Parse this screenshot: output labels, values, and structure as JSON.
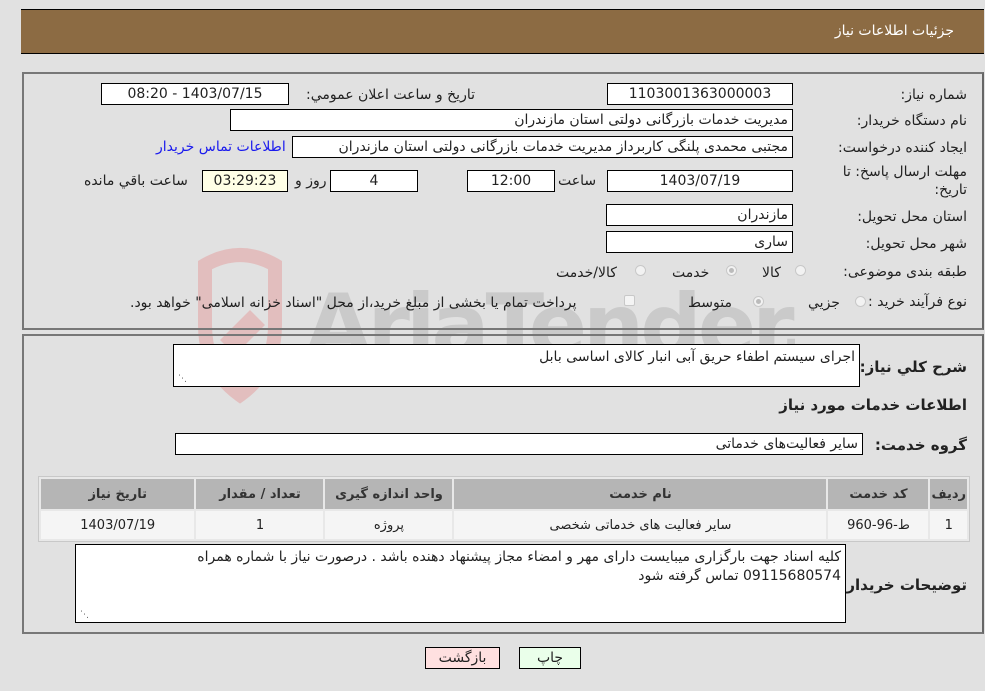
{
  "header": {
    "title": "جزئیات اطلاعات نیاز"
  },
  "form": {
    "need_number": {
      "label": "شماره نیاز:",
      "value": "1103001363000003"
    },
    "announce_datetime": {
      "label": "تاریخ و ساعت اعلان عمومي:",
      "value": "1403/07/15 - 08:20"
    },
    "buyer_org": {
      "label": "نام دستگاه خریدار:",
      "value": "مدیریت خدمات بازرگانی دولتی استان مازندران"
    },
    "requester": {
      "label": "ایجاد کننده درخواست:",
      "value": "مجتبی محمدی پلنگی کاربرداز مدیریت خدمات بازرگانی دولتی استان مازندران"
    },
    "contact_link": "اطلاعات تماس خریدار",
    "deadline": {
      "label": "مهلت ارسال پاسخ: تا تاریخ:",
      "date": "1403/07/19",
      "time_label": "ساعت",
      "time": "12:00",
      "days": "4",
      "days_label": "روز و",
      "remaining": "03:29:23",
      "remaining_label": "ساعت باقي مانده"
    },
    "province": {
      "label": "استان محل تحویل:",
      "value": "مازندران"
    },
    "city": {
      "label": "شهر محل تحویل:",
      "value": "ساری"
    },
    "category": {
      "label": "طبقه بندی موضوعی:",
      "options": [
        "کالا",
        "خدمت",
        "کالا/خدمت"
      ],
      "selected": "خدمت"
    },
    "purchase_type": {
      "label": "نوع فرآیند خرید :",
      "options": [
        "جزيي",
        "متوسط"
      ],
      "selected": "متوسط",
      "treasury_note": "پرداخت تمام یا بخشی از مبلغ خرید،از محل \"اسناد خزانه اسلامی\" خواهد بود."
    }
  },
  "description": {
    "label": "شرح كلي نياز:",
    "value": "اجرای سیستم اطفاء حریق آبی انبار کالای اساسی بابل"
  },
  "services_section": {
    "title": "اطلاعات خدمات مورد نياز",
    "group_label": "گروه خدمت:",
    "group_value": "سایر فعالیت‌های خدماتی"
  },
  "table": {
    "headers": [
      "ردیف",
      "کد خدمت",
      "نام خدمت",
      "واحد اندازه گیری",
      "تعداد / مقدار",
      "تاریخ نیاز"
    ],
    "rows": [
      [
        "1",
        "ط-96-960",
        "سایر فعالیت های خدماتی شخصی",
        "پروژه",
        "1",
        "1403/07/19"
      ]
    ]
  },
  "buyer_notes": {
    "label": "توضیحات خریدار:",
    "line1": "کلیه اسناد جهت بارگزاری میبایست دارای مهر و امضاء مجاز پیشنهاد دهنده باشد . درصورت نیاز با شماره همراه",
    "line2": "09115680574 تماس گرفته شود"
  },
  "buttons": {
    "print": "چاپ",
    "back": "بازگشت"
  },
  "watermark": {
    "text": "AriaTender.neT"
  },
  "colors": {
    "header_bg": "#8c6b43",
    "print_bg": "#eaffea",
    "back_bg": "#ffe0e0",
    "link": "#1a1aee"
  }
}
